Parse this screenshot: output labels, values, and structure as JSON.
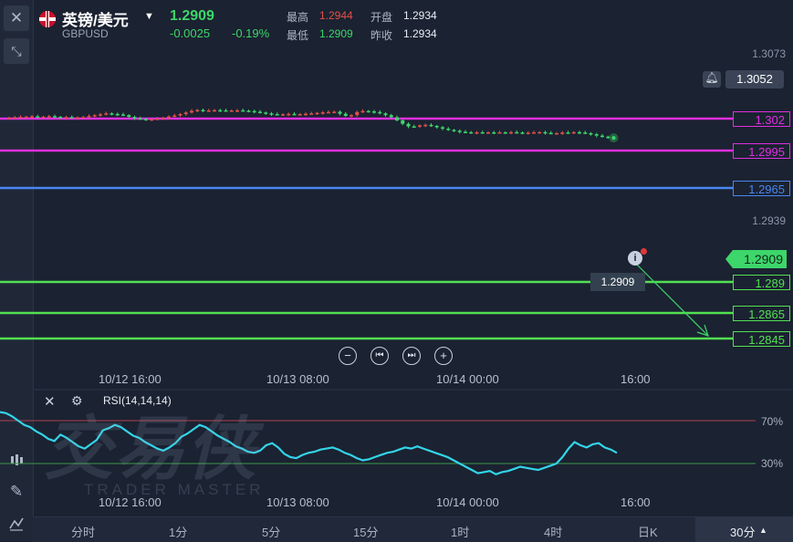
{
  "header": {
    "title": "英镑/美元",
    "symbol": "GBPUSD",
    "price": "1.2909",
    "change": "-0.0025",
    "change_pct": "-0.19%",
    "high_label": "最高",
    "high": "1.2944",
    "open_label": "开盘",
    "open": "1.2934",
    "low_label": "最低",
    "low": "1.2909",
    "prev_label": "昨收",
    "prev_close": "1.2934"
  },
  "price_axis": {
    "top_tick": "1.3073",
    "mid_tick": "1.2939",
    "alert_price": "1.3052",
    "current_price": "1.2909",
    "cursor_price": "1.2909"
  },
  "levels": [
    {
      "label": "1.302",
      "color": "#e02fe0"
    },
    {
      "label": "1.2995",
      "color": "#e02fe0"
    },
    {
      "label": "1.2965",
      "color": "#4a86f0"
    },
    {
      "label": "1.289",
      "color": "#52e052"
    },
    {
      "label": "1.2865",
      "color": "#52e052"
    },
    {
      "label": "1.2845",
      "color": "#52e052"
    }
  ],
  "time_axis": [
    "10/12 16:00",
    "10/13 08:00",
    "10/14 00:00",
    "16:00"
  ],
  "rsi": {
    "label": "RSI(14,14,14)",
    "upper": "70%",
    "lower": "30%",
    "values": [
      78,
      77,
      74,
      70,
      66,
      64,
      60,
      57,
      53,
      51,
      57,
      54,
      50,
      46,
      44,
      48,
      52,
      61,
      63,
      66,
      64,
      60,
      56,
      54,
      50,
      47,
      44,
      42,
      45,
      49,
      55,
      58,
      62,
      66,
      64,
      60,
      56,
      53,
      50,
      46,
      44,
      41,
      40,
      42,
      47,
      49,
      45,
      39,
      36,
      35,
      38,
      40,
      41,
      43,
      44,
      45,
      43,
      40,
      38,
      35,
      33,
      34,
      36,
      38,
      40,
      41,
      43,
      45,
      44,
      46,
      44,
      42,
      40,
      38,
      36,
      33,
      30,
      27,
      24,
      21,
      22,
      23,
      20,
      22,
      23,
      25,
      27,
      26,
      25,
      24,
      26,
      28,
      30,
      36,
      44,
      50,
      47,
      45,
      48,
      49,
      45,
      43,
      40
    ]
  },
  "watermark": {
    "cn": "交易侠",
    "en": "TRADER MASTER"
  },
  "bottom_tabs": [
    "分时",
    "1分",
    "5分",
    "15分",
    "1时",
    "4时",
    "日K",
    "30分"
  ],
  "active_tab": "30分",
  "colors": {
    "up": "#e0504a",
    "down": "#3dd66a",
    "rsi": "#33d4e8",
    "bg": "#1b2231"
  }
}
